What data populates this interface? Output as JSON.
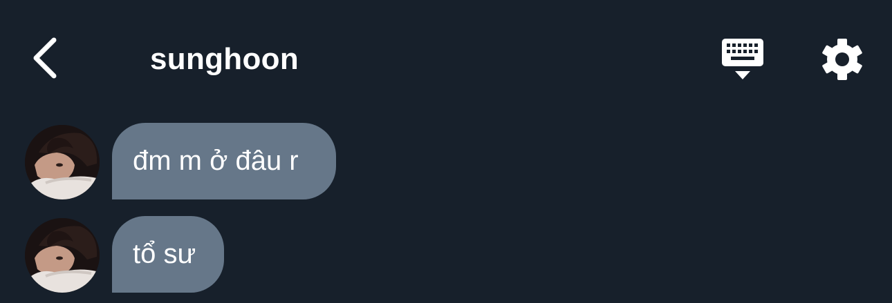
{
  "header": {
    "title": "sunghoon",
    "back_icon": "chevron-left-icon",
    "keyboard_icon": "keyboard-hide-icon",
    "settings_icon": "gear-icon"
  },
  "messages": [
    {
      "text": "đm m ở đâu r",
      "sender": "sunghoon",
      "avatar_icon": "profile-photo"
    },
    {
      "text": "tổ sư",
      "sender": "sunghoon",
      "avatar_icon": "profile-photo"
    }
  ],
  "colors": {
    "background": "#17202b",
    "bubble": "#667789",
    "text": "#ffffff"
  }
}
